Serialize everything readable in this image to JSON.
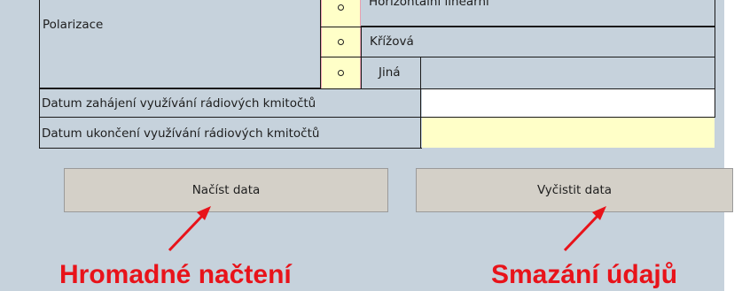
{
  "form": {
    "polarization_label": "Polarizace",
    "options": [
      {
        "label": "Horizontální lineární"
      },
      {
        "label": "Křížová"
      },
      {
        "label": "Jiná"
      }
    ],
    "start_date_label": "Datum zahájení využívání rádiových kmitočtů",
    "end_date_label": "Datum ukončení využívání rádiových kmitočtů",
    "start_date_value": "",
    "end_date_value": ""
  },
  "buttons": {
    "load_label": "Načíst data",
    "clear_label": "Vyčistit data"
  },
  "annotations": {
    "load_caption": "Hromadné načtení",
    "clear_caption": "Smazání údajů",
    "color": "#e8131a"
  }
}
